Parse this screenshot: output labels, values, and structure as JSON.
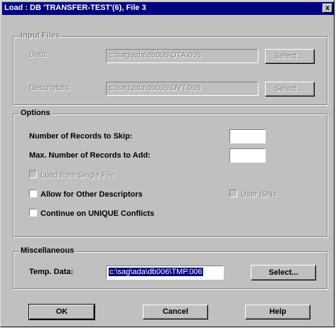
{
  "window": {
    "title": "Load : DB 'TRANSFER-TEST'(6), File 3",
    "close_glyph": "x"
  },
  "input_files": {
    "legend": "Input Files",
    "data_label": "Data:",
    "data_value": "c:\\sag\\ada\\db006\\DTA.006",
    "data_select": "Select ...",
    "descriptors_label": "Descriptors:",
    "descriptors_value": "c:\\sag\\ada\\db006\\DVT.006",
    "descriptors_select": "Select ..."
  },
  "options": {
    "legend": "Options",
    "skip_label": "Number of Records to Skip:",
    "skip_value": "",
    "add_label": "Max. Number of Records to Add:",
    "add_value": "",
    "single_file_label": "Load from Single File",
    "single_file_checked": false,
    "other_descriptors_label": "Allow for Other Descriptors",
    "other_descriptors_checked": false,
    "user_isns_label": "User ISNs",
    "user_isns_checked": false,
    "unique_conflicts_label": "Continue on UNIQUE Conflicts",
    "unique_conflicts_checked": false
  },
  "misc": {
    "legend": "Miscellaneous",
    "temp_label": "Temp. Data:",
    "temp_value": "c:\\sag\\ada\\db006\\TMP.006",
    "temp_select": "Select..."
  },
  "buttons": {
    "ok": "OK",
    "cancel": "Cancel",
    "help": "Help"
  }
}
